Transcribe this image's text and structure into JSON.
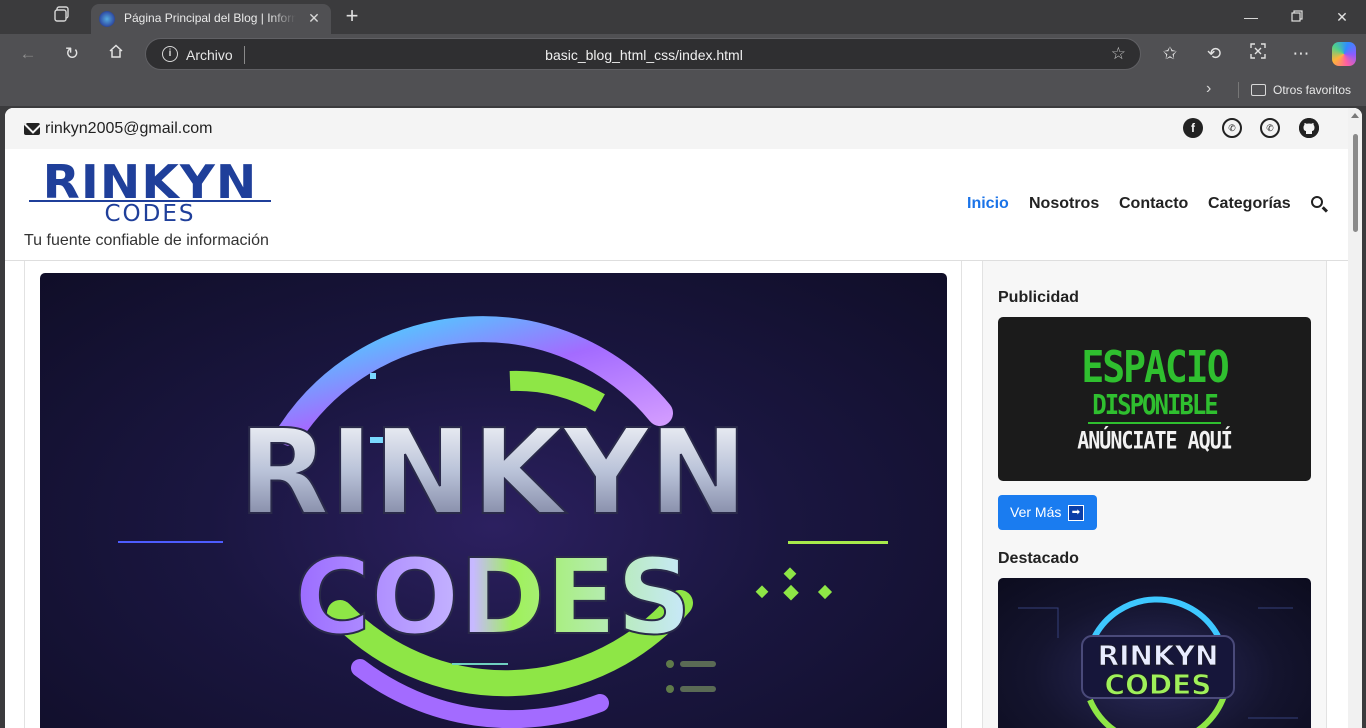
{
  "browser": {
    "tab_title": "Página Principal del Blog | Información",
    "scheme_label": "Archivo",
    "url": "basic_blog_html_css/index.html",
    "favorites_folder": "Otros favoritos"
  },
  "page": {
    "email": "rinkyn2005@gmail.com",
    "social_icons": [
      "facebook-icon",
      "whatsapp-icon",
      "whatsapp-icon",
      "github-icon"
    ],
    "logo_main": "RINKYN",
    "logo_sub": "CODES",
    "tagline": "Tu fuente confiable de información",
    "nav": [
      {
        "label": "Inicio",
        "active": true
      },
      {
        "label": "Nosotros",
        "active": false
      },
      {
        "label": "Contacto",
        "active": false
      },
      {
        "label": "Categorías",
        "active": false
      }
    ],
    "hero": {
      "logo_line1": "RINKYN",
      "logo_line2": "CODES"
    },
    "sidebar": {
      "ad_heading": "Publicidad",
      "ad_line1": "ESPACIO",
      "ad_line2": "DISPONIBLE",
      "ad_line3": "ANÚNCIATE AQUÍ",
      "ad_button": "Ver Más",
      "featured_heading": "Destacado",
      "featured_line1": "RINKYN",
      "featured_line2": "CODES"
    }
  },
  "colors": {
    "accent": "#1a73e8",
    "logo_blue": "#1f3f9a",
    "ad_green": "#2fbf2f",
    "button_blue": "#1a7cf0"
  }
}
